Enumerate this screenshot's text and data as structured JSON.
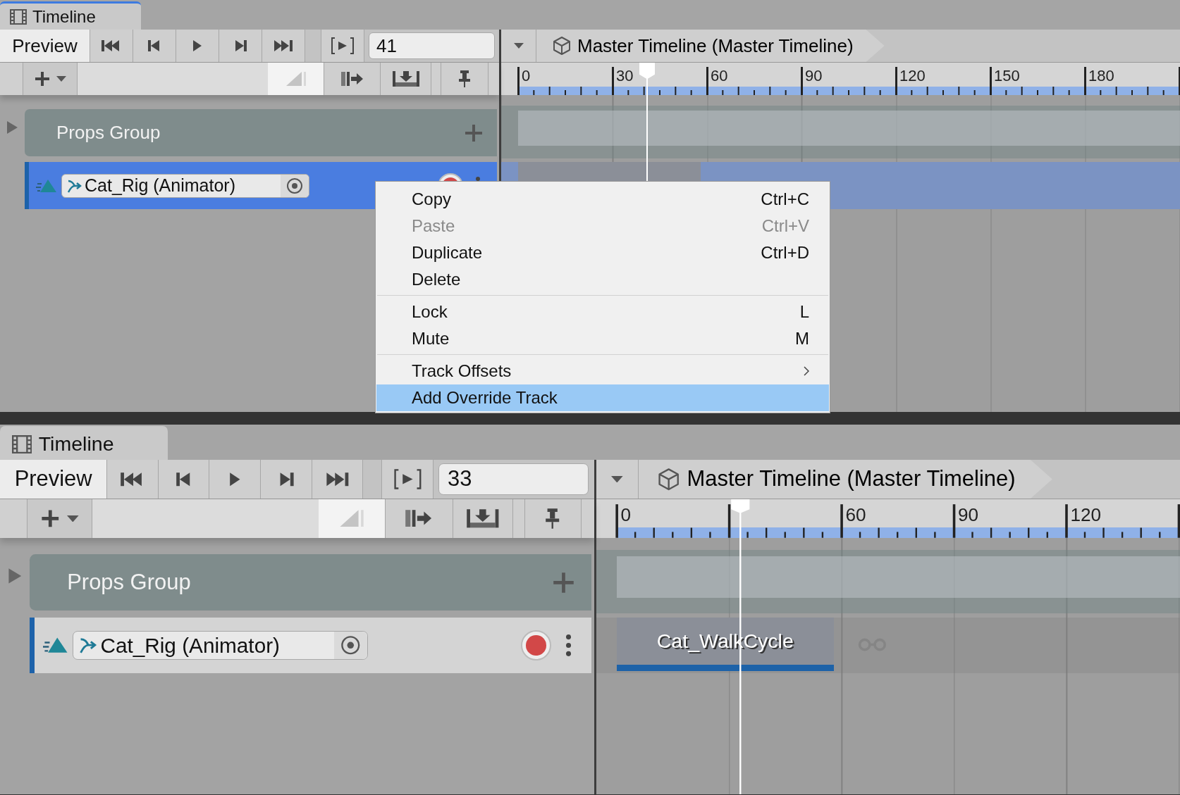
{
  "panels": [
    {
      "tab": {
        "label": "Timeline",
        "focused": true
      },
      "preview": "Preview",
      "frame": "41",
      "breadcrumb": "Master Timeline (Master Timeline)",
      "ruler_labels": [
        "0",
        "30",
        "60",
        "90",
        "120",
        "150",
        "180"
      ],
      "group": {
        "name": "Props Group",
        "expanded": false
      },
      "track": {
        "name": "Cat_Rig (Animator)",
        "selected": true
      }
    },
    {
      "tab": {
        "label": "Timeline",
        "focused": false
      },
      "preview": "Preview",
      "frame": "33",
      "breadcrumb": "Master Timeline (Master Timeline)",
      "ruler_labels": [
        "0",
        "60",
        "90",
        "120"
      ],
      "group": {
        "name": "Props Group",
        "expanded": false
      },
      "track": {
        "name": "Cat_Rig (Animator)",
        "selected": false
      },
      "clip": {
        "label": "Cat_WalkCycle"
      }
    }
  ],
  "context_menu": {
    "items": [
      {
        "kind": "item",
        "label": "Copy",
        "shortcut": "Ctrl+C",
        "disabled": false,
        "selected": false
      },
      {
        "kind": "item",
        "label": "Paste",
        "shortcut": "Ctrl+V",
        "disabled": true,
        "selected": false
      },
      {
        "kind": "item",
        "label": "Duplicate",
        "shortcut": "Ctrl+D",
        "disabled": false,
        "selected": false
      },
      {
        "kind": "item",
        "label": "Delete",
        "disabled": false,
        "selected": false
      },
      {
        "kind": "separator"
      },
      {
        "kind": "item",
        "label": "Lock",
        "shortcut": "L",
        "disabled": false,
        "selected": false
      },
      {
        "kind": "item",
        "label": "Mute",
        "shortcut": "M",
        "disabled": false,
        "selected": false
      },
      {
        "kind": "separator"
      },
      {
        "kind": "submenu",
        "label": "Track Offsets",
        "disabled": false,
        "selected": false
      },
      {
        "kind": "item",
        "label": "Add Override Track",
        "disabled": false,
        "selected": true
      }
    ]
  }
}
